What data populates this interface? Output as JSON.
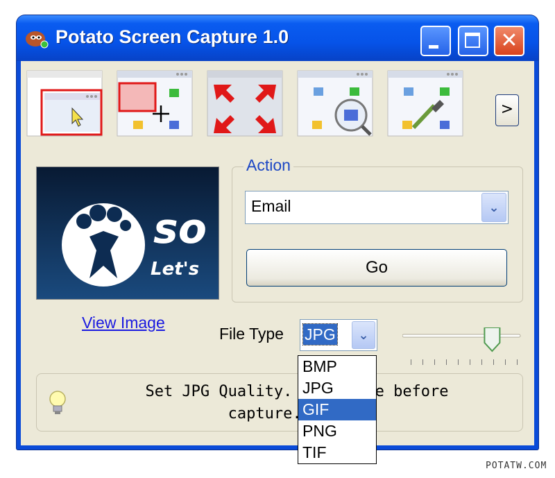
{
  "window": {
    "title": "Potato Screen Capture 1.0"
  },
  "toolbar": {
    "tools": [
      {
        "icon": "window-capture-icon"
      },
      {
        "icon": "region-capture-icon"
      },
      {
        "icon": "fullscreen-capture-icon"
      },
      {
        "icon": "zoom-capture-icon"
      },
      {
        "icon": "color-picker-icon"
      }
    ],
    "next_label": ">"
  },
  "preview": {
    "logo_text_1": "so",
    "logo_text_2": "Let's"
  },
  "action": {
    "group_label": "Action",
    "selected": "Email",
    "go_label": "Go"
  },
  "view_image_label": "View Image",
  "file_type": {
    "label": "File Type",
    "selected": "JPG",
    "options": [
      "BMP",
      "JPG",
      "GIF",
      "PNG",
      "TIF"
    ],
    "highlighted": "GIF"
  },
  "quality_slider": {
    "value": 0.8
  },
  "tip": {
    "text": "Set JPG Quality. Adju      alue before\ncapture. Def        0."
  },
  "watermark": "POTATW.COM",
  "colors": {
    "titlebar": "#0653e8",
    "client": "#ece9d8",
    "accent": "#316ac5",
    "group_title": "#1b46c4"
  }
}
